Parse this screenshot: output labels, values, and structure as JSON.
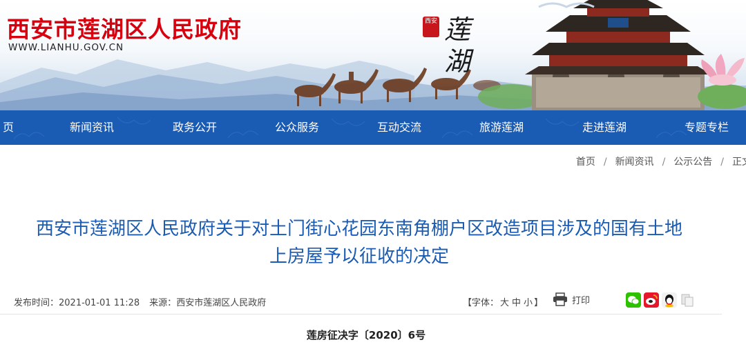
{
  "header": {
    "site_title": "西安市莲湖区人民政府",
    "site_url": "WWW.LIANHU.GOV.CN",
    "seal_text": "西安",
    "brand_calligraphy": "莲湖"
  },
  "nav": {
    "items": [
      "页",
      "新闻资讯",
      "政务公开",
      "公众服务",
      "互动交流",
      "旅游莲湖",
      "走进莲湖",
      "专题专栏"
    ]
  },
  "breadcrumb": {
    "items": [
      "首页",
      "新闻资讯",
      "公示公告",
      "正文"
    ],
    "separator": "/"
  },
  "article": {
    "title_line1": "西安市莲湖区人民政府关于对土门街心花园东南角棚户区改造项目涉及的国有土地",
    "title_line2": "上房屋予以征收的决定",
    "publish_label": "发布时间：",
    "publish_time": "2021-01-01 11:28",
    "source_label": "来源：",
    "source": "西安市莲湖区人民政府",
    "font_size_label": "【字体：",
    "font_size_options": [
      "大",
      "中",
      "小"
    ],
    "font_size_close": "】",
    "print_label": "打印",
    "doc_number": "莲房征决字〔2020〕6号"
  },
  "icons": {
    "wechat": "wechat-icon",
    "weibo": "weibo-icon",
    "qq": "qq-icon",
    "copy": "copy-icon",
    "print": "printer-icon"
  },
  "colors": {
    "brand_red": "#d7000f",
    "nav_blue": "#1a5bb3",
    "title_blue": "#1a5bb3"
  }
}
